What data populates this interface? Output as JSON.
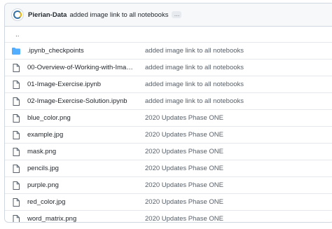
{
  "commit": {
    "author": "Pierian-Data",
    "message": "added image link to all notebooks",
    "ellipsis": "…"
  },
  "parent_dir": "..",
  "files": [
    {
      "type": "folder",
      "name": ".ipynb_checkpoints",
      "message": "added image link to all notebooks"
    },
    {
      "type": "file",
      "name": "00-Overview-of-Working-with-Images.i…",
      "message": "added image link to all notebooks"
    },
    {
      "type": "file",
      "name": "01-Image-Exercise.ipynb",
      "message": "added image link to all notebooks"
    },
    {
      "type": "file",
      "name": "02-Image-Exercise-Solution.ipynb",
      "message": "added image link to all notebooks"
    },
    {
      "type": "file",
      "name": "blue_color.png",
      "message": "2020 Updates Phase ONE"
    },
    {
      "type": "file",
      "name": "example.jpg",
      "message": "2020 Updates Phase ONE"
    },
    {
      "type": "file",
      "name": "mask.png",
      "message": "2020 Updates Phase ONE"
    },
    {
      "type": "file",
      "name": "pencils.jpg",
      "message": "2020 Updates Phase ONE"
    },
    {
      "type": "file",
      "name": "purple.png",
      "message": "2020 Updates Phase ONE"
    },
    {
      "type": "file",
      "name": "red_color.jpg",
      "message": "2020 Updates Phase ONE"
    },
    {
      "type": "file",
      "name": "word_matrix.png",
      "message": "2020 Updates Phase ONE"
    }
  ],
  "colors": {
    "folder": "#54aeff",
    "file_icon": "#57606a"
  }
}
